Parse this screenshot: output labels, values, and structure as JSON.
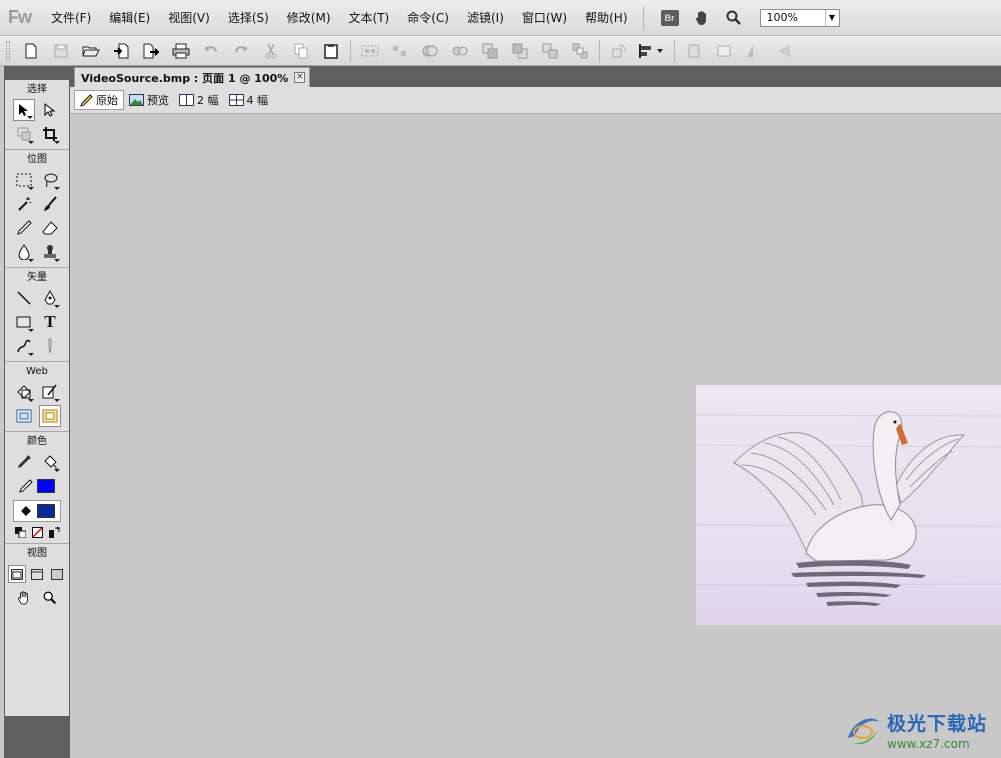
{
  "app": {
    "logo": "Fw"
  },
  "menu": {
    "items": [
      "文件(F)",
      "编辑(E)",
      "视图(V)",
      "选择(S)",
      "修改(M)",
      "文本(T)",
      "命令(C)",
      "滤镜(I)",
      "窗口(W)",
      "帮助(H)"
    ],
    "bridge_label": "Br",
    "zoom_value": "100%"
  },
  "toolbar": {
    "icons": [
      "new-icon",
      "save-icon",
      "open-icon",
      "import-icon",
      "export-icon",
      "print-icon",
      "undo-icon",
      "redo-icon",
      "cut-icon",
      "copy-icon",
      "paste-icon",
      "group-icon",
      "ungroup-icon",
      "join-icon",
      "split-icon",
      "bring-forward-icon",
      "send-backward-icon",
      "bring-front-icon",
      "send-back-icon",
      "rotate-icon",
      "align-icon",
      "flip-horizontal-icon",
      "flip-vertical-icon",
      "mirror-icon",
      "mirror-left-icon"
    ]
  },
  "tools": {
    "sections": {
      "select": "选择",
      "bitmap": "位图",
      "vector": "矢量",
      "web": "Web",
      "color": "颜色",
      "view": "视图"
    },
    "text_tool_glyph": "T",
    "stroke_color": "#0000ff",
    "fill_color": "#0a2a9c"
  },
  "document": {
    "tab_title": "VideoSource.bmp : 页面 1 @ 100%",
    "close_glyph": "×",
    "views": [
      "原始",
      "预览",
      "2 幅",
      "4 幅"
    ]
  },
  "watermark": {
    "title": "极光下载站",
    "url": "www.xz7.com"
  }
}
